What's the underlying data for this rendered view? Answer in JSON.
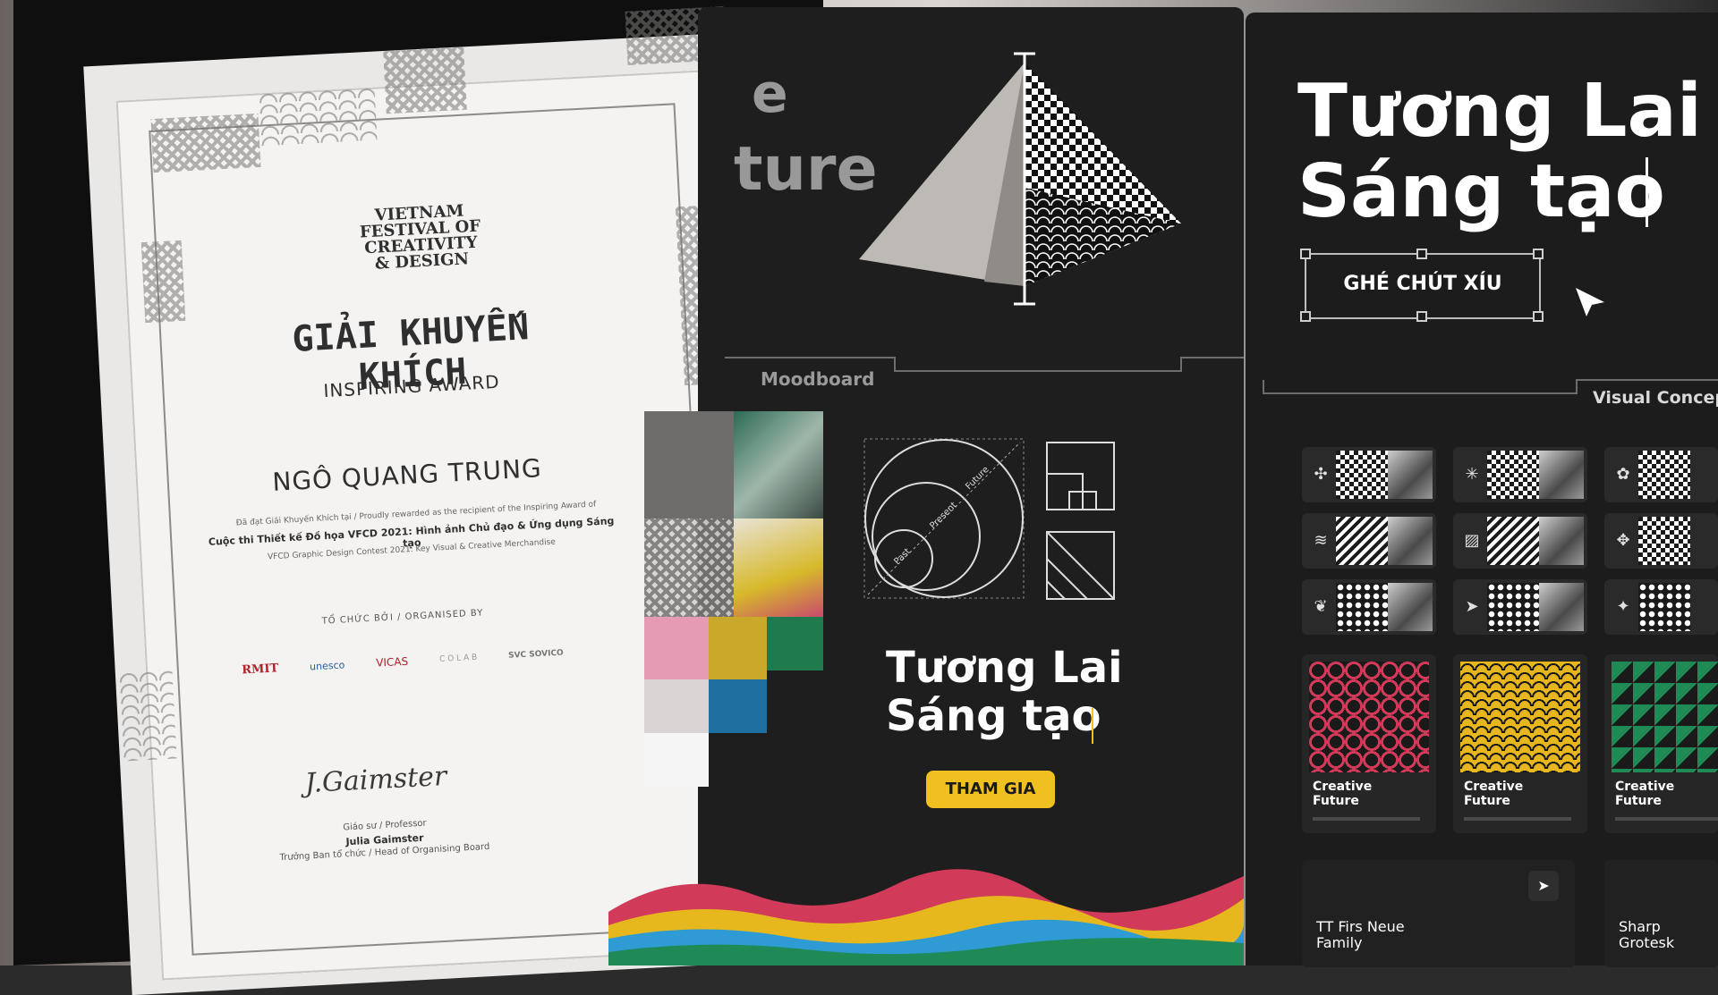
{
  "certificate": {
    "festival_lines": [
      "VIETNAM",
      "FESTIVAL OF",
      "CREATIVITY",
      "& DESIGN"
    ],
    "award_title": "GIẢI KHUYẾN KHÍCH",
    "award_subtitle": "INSPIRING AWARD",
    "recipient": "NGÔ QUANG TRUNG",
    "line1": "Đã đạt Giải Khuyến Khích tại / Proudly rewarded as the recipient of the Inspiring Award of",
    "line2": "Cuộc thi Thiết kế Đồ họa VFCD 2021: Hình ảnh Chủ đạo & Ứng dụng Sáng tạo",
    "line3": "VFCD Graphic Design Contest 2021: Key Visual & Creative Merchandise",
    "organised_by": "TỔ CHỨC BỞI / ORGANISED BY",
    "logos": [
      "RMIT",
      "unesco",
      "VICAS",
      "C O L A B",
      "SVC SOVICO"
    ],
    "signature": "J.Gaimster",
    "sign_role": "Giáo sư / Professor",
    "sign_name": "Julia Gaimster",
    "sign_title": "Trưởng Ban tổ chức / Head of Organising Board"
  },
  "ghost_text": {
    "line1": "e",
    "line2": "ture"
  },
  "moodboard": {
    "label": "Moodboard"
  },
  "mid": {
    "diagram_labels": [
      "Future",
      "Present",
      "Past"
    ],
    "title_line1": "Tương Lai",
    "title_line2": "Sáng tạo",
    "cta": "THAM GIA",
    "accent": "#f0c020"
  },
  "right": {
    "title_line1": "Tương Lai",
    "title_line2": "Sáng tạo",
    "cta": "GHÉ CHÚT XÍU",
    "section_label": "Visual Concep",
    "cards": [
      {
        "title_line1": "Creative",
        "title_line2": "Future",
        "color": "#d23a5a"
      },
      {
        "title_line1": "Creative",
        "title_line2": "Future",
        "color": "#e6b81e"
      },
      {
        "title_line1": "Creative",
        "title_line2": "Future",
        "color": "#1f8a55"
      }
    ],
    "fonts": [
      {
        "name_line1": "TT Firs Neue",
        "name_line2": "Family"
      },
      {
        "name_line1": "Sharp",
        "name_line2": "Grotesk"
      }
    ]
  },
  "colors": {
    "pink": "#d23a5a",
    "yellow": "#e6b81e",
    "green": "#1f8a55",
    "blue": "#1f6fa0",
    "dark": "#1c1c1c"
  }
}
